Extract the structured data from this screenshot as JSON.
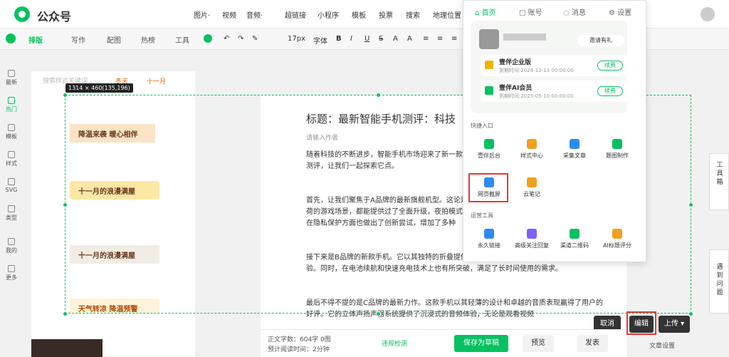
{
  "app": {
    "title": "公众号"
  },
  "topmenu": [
    "图片·",
    "视频",
    "音频·",
    "超链接",
    "小程序",
    "模板",
    "投票",
    "搜索",
    "地理位置"
  ],
  "toolbar": {
    "tabs": [
      "排版",
      "写作",
      "配图",
      "热榜",
      "工具"
    ],
    "font_size": "17px",
    "font_label": "字体"
  },
  "sidebar": {
    "items": [
      "最新",
      "热门",
      "模板",
      "样式",
      "SVG",
      "类型",
      "我的",
      "更多"
    ]
  },
  "panel": {
    "search_placeholder": "搜索样式关键词",
    "tags": [
      "冬天",
      "十一月"
    ],
    "size_info": "1314 × 460(135,196)",
    "banners": [
      "降温来袭 暖心相伴",
      "十一月的浪漫满屋",
      "十一月的浪漫满屋",
      "天气转凉 降温预警"
    ]
  },
  "editor": {
    "title": "标题：最新智能手机测评：科技",
    "author_placeholder": "请输入作者",
    "paragraphs": [
      "随着科技的不断进步，智能手机市场迎来了新一款最新智能手机的深度测评，让我们一起探索它点。",
      "首先，让我们聚焦于A品牌的最新旗舰机型。这论是日常使用还是高负荷的游戏场景，都能提供过了全面升级，夜拍模式下的图像清晰度和色在隐私保护方面也做出了创新尝试，增加了多种",
      "接下来是B品牌的新款手机。它以其独特的折叠提供了更大的显示面积，还带来了全新的交互体验。同时，在电池续航和快速充电技术上也有所突破，满足了长时间使用的需求。",
      "最后不得不提的是C品牌的最新力作。这款手机以其轻薄的设计和卓越的音质表现赢得了用户的好评。它的立体声扬声器系统提供了沉浸式的音频体验，无论是观看视频"
    ]
  },
  "bottombar": {
    "word_count": "正文字数：604字 0图",
    "read_time": "预计阅读时间：2分钟",
    "violation_check": "违规检测",
    "save_draft": "保存为草稿",
    "preview": "预览",
    "publish": "发表",
    "article_settings": "文章设置"
  },
  "crop_actions": {
    "cancel": "取消",
    "edit": "编辑",
    "upload": "上传"
  },
  "popup": {
    "nav": [
      "首页",
      "账号",
      "消息",
      "设置"
    ],
    "invite": "邀请有礼",
    "memberships": [
      {
        "name": "壹伴企业版",
        "date": "到期时间:2024-12-13 00:00:00",
        "action": "续费"
      },
      {
        "name": "壹伴AI会员",
        "date": "到期时间:2025-05-10 00:00:00",
        "action": "续费"
      }
    ],
    "quick_title": "快捷入口",
    "quick_items": [
      "壹伴后台",
      "样式中心",
      "采集文章",
      "题图制作",
      "网页截屏",
      "云笔记"
    ],
    "ops_title": "运营工具",
    "ops_items": [
      "永久链接",
      "高级关注回复",
      "渠道二维码",
      "AI标题评分"
    ]
  },
  "rightfloat": {
    "toolbox": "工具箱",
    "feedback": "遇到问题"
  },
  "colors": {
    "brand": "#07c160",
    "dark_button": "#333333",
    "highlight": "#e53935"
  }
}
